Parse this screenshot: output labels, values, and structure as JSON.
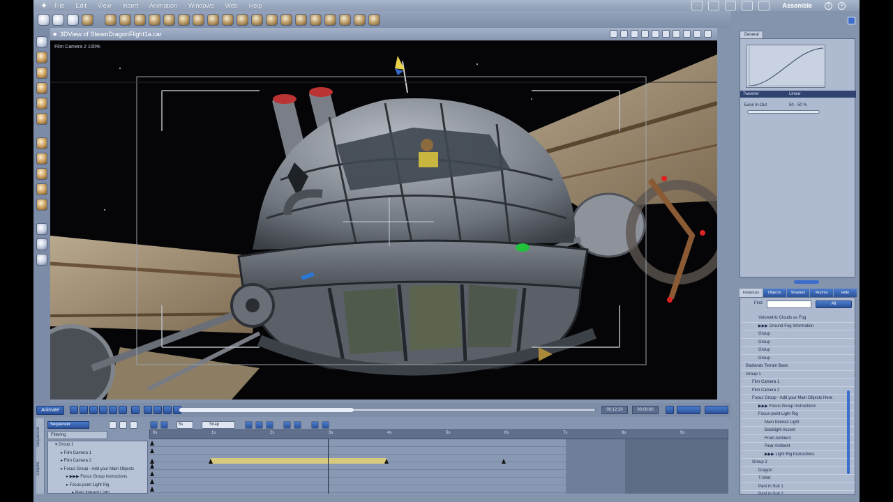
{
  "app": {
    "menu": [
      "File",
      "Edit",
      "View",
      "Insert",
      "Animation",
      "Windows",
      "Web",
      "Help"
    ],
    "room": "Assemble",
    "help_label": "?",
    "close_label": "×"
  },
  "view": {
    "title": "3DView of SteamDragonFlight1a.car",
    "camera_label": "Film Camera 2 100%"
  },
  "timeline": {
    "animate_label": "Animate",
    "time_current": "00:12:20",
    "time_end": "00:08:00",
    "sequencer_label": "Sequencer",
    "snap_label": "Snap",
    "frame_label": "5s",
    "filtering_label": "Filtering",
    "side_tabs": [
      "Sequencer",
      "Graphs"
    ],
    "ruler_ticks": [
      "0s",
      "1s",
      "2s",
      "3s",
      "4s",
      "5s",
      "6s",
      "7s",
      "8s",
      "9s"
    ],
    "tree": [
      {
        "label": "Group 1",
        "indent": 0
      },
      {
        "label": "Film Camera 1",
        "indent": 1
      },
      {
        "label": "Film Camera 2",
        "indent": 1
      },
      {
        "label": "Focus Group - Add your Main Objects",
        "indent": 1
      },
      {
        "label": "▶▶▶ Focus Group Instructions",
        "indent": 2
      },
      {
        "label": "Focus-point Light Rig",
        "indent": 2
      },
      {
        "label": "Main Interest Light",
        "indent": 3
      }
    ],
    "keybar_start": 1.0,
    "keybar_end": 4.0,
    "keyframes": [
      0,
      1.0,
      4.0,
      6.0
    ],
    "playhead": 3.0
  },
  "general": {
    "tab_label": "General",
    "curve_header": "Tweener",
    "curve_mode": "Linear",
    "ease_label": "Ease In-Out",
    "ease_value": "50 - 50 %"
  },
  "scene": {
    "tabs": [
      "Instances",
      "Objects",
      "Shaders",
      "Rooms",
      "Hide"
    ],
    "find_label": "Find",
    "find_button": "All",
    "tree": [
      {
        "label": "Volumetric Clouds as Fog",
        "indent": 2
      },
      {
        "label": "▶▶▶ Ground Fog Information",
        "indent": 2
      },
      {
        "label": "Group",
        "indent": 2
      },
      {
        "label": "Group",
        "indent": 2
      },
      {
        "label": "Group",
        "indent": 2
      },
      {
        "label": "Group",
        "indent": 2
      },
      {
        "label": "Badlands Terrain Base",
        "indent": 0
      },
      {
        "label": "Group 1",
        "indent": 0
      },
      {
        "label": "Film Camera 1",
        "indent": 1
      },
      {
        "label": "Film Camera 2",
        "indent": 1
      },
      {
        "label": "Focus Group - Add your Main Objects Here",
        "indent": 1
      },
      {
        "label": "▶▶▶ Focus Group Instructions",
        "indent": 2
      },
      {
        "label": "Focus-point Light Rig",
        "indent": 2
      },
      {
        "label": "Main Interest Light",
        "indent": 3
      },
      {
        "label": "Backlight Accent",
        "indent": 3
      },
      {
        "label": "Front Ambient",
        "indent": 3
      },
      {
        "label": "Rear Ambient",
        "indent": 3
      },
      {
        "label": "▶▶▶ Light Rig Instructions",
        "indent": 3
      },
      {
        "label": "Group 2",
        "indent": 1
      },
      {
        "label": "Dragon",
        "indent": 2
      },
      {
        "label": "T-Shirt",
        "indent": 2
      },
      {
        "label": "Pant in Suit 1",
        "indent": 2
      },
      {
        "label": "Pant in Suit 2",
        "indent": 2
      }
    ]
  }
}
